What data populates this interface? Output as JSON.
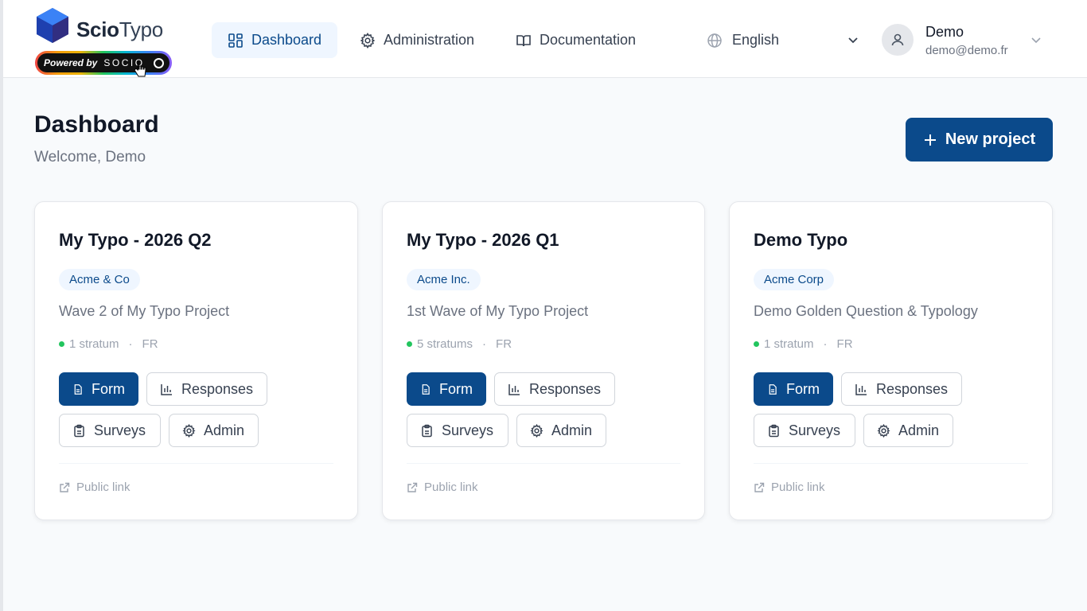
{
  "colors": {
    "primary": "#0b4a8b",
    "active_bg": "#eff6ff",
    "status_green": "#22c55e"
  },
  "brand": {
    "name_bold": "Scio",
    "name_light": "Typo",
    "powered_label": "Powered by",
    "powered_brand": "SOCIO"
  },
  "nav": {
    "dashboard": "Dashboard",
    "administration": "Administration",
    "documentation": "Documentation"
  },
  "language": {
    "selected": "English"
  },
  "user": {
    "name": "Demo",
    "email": "demo@demo.fr"
  },
  "page": {
    "title": "Dashboard",
    "subtitle": "Welcome, Demo",
    "new_project": "New project"
  },
  "projects": [
    {
      "title": "My Typo - 2026 Q2",
      "client": "Acme & Co",
      "description": "Wave 2 of My Typo Project",
      "strata": "1 stratum",
      "lang": "FR",
      "actions": {
        "form": "Form",
        "responses": "Responses",
        "surveys": "Surveys",
        "admin": "Admin"
      },
      "public_link": "Public link"
    },
    {
      "title": "My Typo - 2026 Q1",
      "client": "Acme Inc.",
      "description": "1st Wave of My Typo Project",
      "strata": "5 stratums",
      "lang": "FR",
      "actions": {
        "form": "Form",
        "responses": "Responses",
        "surveys": "Surveys",
        "admin": "Admin"
      },
      "public_link": "Public link"
    },
    {
      "title": "Demo Typo",
      "client": "Acme Corp",
      "description": "Demo Golden Question & Typology",
      "strata": "1 stratum",
      "lang": "FR",
      "actions": {
        "form": "Form",
        "responses": "Responses",
        "surveys": "Surveys",
        "admin": "Admin"
      },
      "public_link": "Public link"
    }
  ],
  "meta_separator": "·"
}
